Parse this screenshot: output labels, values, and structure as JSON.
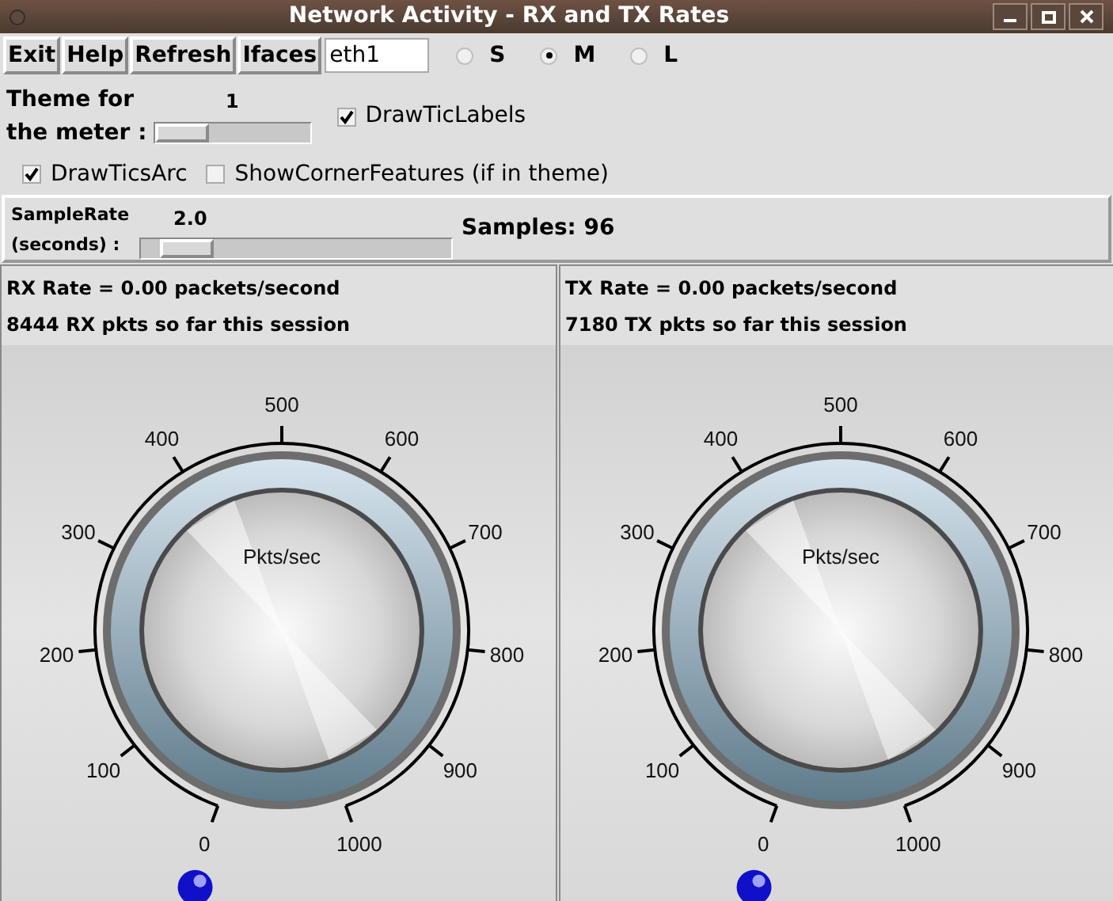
{
  "window": {
    "title": "Network Activity - RX and TX Rates"
  },
  "toolbar": {
    "buttons": [
      "Exit",
      "Help",
      "Refresh",
      "Ifaces"
    ],
    "interface": "eth1",
    "sizes": [
      {
        "label": "S",
        "selected": false
      },
      {
        "label": "M",
        "selected": true
      },
      {
        "label": "L",
        "selected": false
      }
    ]
  },
  "theme": {
    "label_lines": [
      "Theme for",
      "the meter :"
    ],
    "value": "1",
    "level": 0
  },
  "checkboxes": [
    {
      "label": "DrawTicLabels",
      "checked": true
    },
    {
      "label": "DrawTicsArc",
      "checked": true
    },
    {
      "label": "ShowCornerFeatures (if in theme)",
      "checked": false
    }
  ],
  "sample": {
    "label_lines": [
      "SampleRate",
      "(seconds) :"
    ],
    "value": "2.0",
    "level": 0.08,
    "samples": "Samples: 96"
  },
  "meters": [
    {
      "rate": "RX Rate = 0.00 packets/second",
      "count": "8444 RX pkts so far this session",
      "units": "Pkts/sec",
      "tick_labels": [
        "0",
        "100",
        "200",
        "300",
        "400",
        "500",
        "600",
        "700",
        "800",
        "900",
        "1000"
      ]
    },
    {
      "rate": "TX Rate = 0.00 packets/second",
      "count": "7180 TX pkts so far this session",
      "units": "Pkts/sec",
      "tick_labels": [
        "0",
        "100",
        "200",
        "300",
        "400",
        "500",
        "600",
        "700",
        "800",
        "900",
        "1000"
      ]
    }
  ]
}
